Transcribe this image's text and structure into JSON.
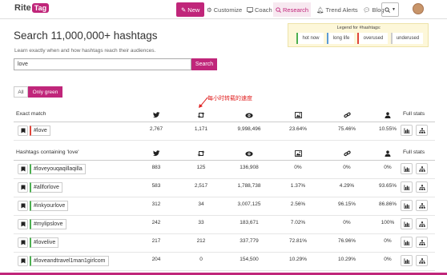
{
  "app": {
    "logo_text": "Rite",
    "logo_badge": "Tag"
  },
  "nav": {
    "new_label": "New",
    "customize_label": "Customize",
    "coach_label": "Coach",
    "research_label": "Research",
    "trend_alerts_label": "Trend Alerts",
    "blog_label": "Blog"
  },
  "legend": {
    "title": "Legend for #hashtags:",
    "hot_now": "hot now",
    "long_life": "long life",
    "overused": "overused",
    "underused": "underused"
  },
  "page": {
    "title": "Search 11,000,000+ hashtags",
    "subtitle": "Learn exactly when and how hashtags reach their audiences."
  },
  "search": {
    "value": "love",
    "button_label": "Search"
  },
  "filters": {
    "all_label": "All",
    "only_green_label": "Only green"
  },
  "annotation": {
    "text": "每小时转载的速度"
  },
  "exact_match": {
    "label": "Exact match",
    "full_stats_label": "Full stats",
    "row": {
      "tag": "#love",
      "status": "overused",
      "tweets": "2,767",
      "retweets": "1,171",
      "exposure": "9,998,496",
      "images": "23.64%",
      "links": "75.46%",
      "mentions": "10.55%"
    }
  },
  "containing": {
    "label": "Hashtags containing 'love'",
    "full_stats_label": "Full stats",
    "rows": [
      {
        "tag": "#loveyouqaqillaqilla",
        "status": "hot now",
        "tweets": "883",
        "retweets": "125",
        "exposure": "136,908",
        "images": "0%",
        "links": "0%",
        "mentions": "0%"
      },
      {
        "tag": "#allforlove",
        "status": "hot now",
        "tweets": "583",
        "retweets": "2,517",
        "exposure": "1,788,738",
        "images": "1.37%",
        "links": "4.29%",
        "mentions": "93.65%"
      },
      {
        "tag": "#inkyourlove",
        "status": "hot now",
        "tweets": "312",
        "retweets": "34",
        "exposure": "3,007,125",
        "images": "2.56%",
        "links": "96.15%",
        "mentions": "86.86%"
      },
      {
        "tag": "#mylipslove",
        "status": "hot now",
        "tweets": "242",
        "retweets": "33",
        "exposure": "183,671",
        "images": "7.02%",
        "links": "0%",
        "mentions": "100%"
      },
      {
        "tag": "#lovelive",
        "status": "hot now",
        "tweets": "217",
        "retweets": "212",
        "exposure": "337,779",
        "images": "72.81%",
        "links": "76.96%",
        "mentions": "0%"
      },
      {
        "tag": "#loveandtravel1man1girlcom",
        "status": "hot now",
        "tweets": "204",
        "retweets": "0",
        "exposure": "154,500",
        "images": "10.29%",
        "links": "10.29%",
        "mentions": "0%"
      }
    ]
  },
  "colors": {
    "brand": "#c0267a",
    "hot_now": "#4caf50",
    "long_life": "#5b9bd5",
    "overused": "#e0453a",
    "annotation": "#e02020"
  }
}
